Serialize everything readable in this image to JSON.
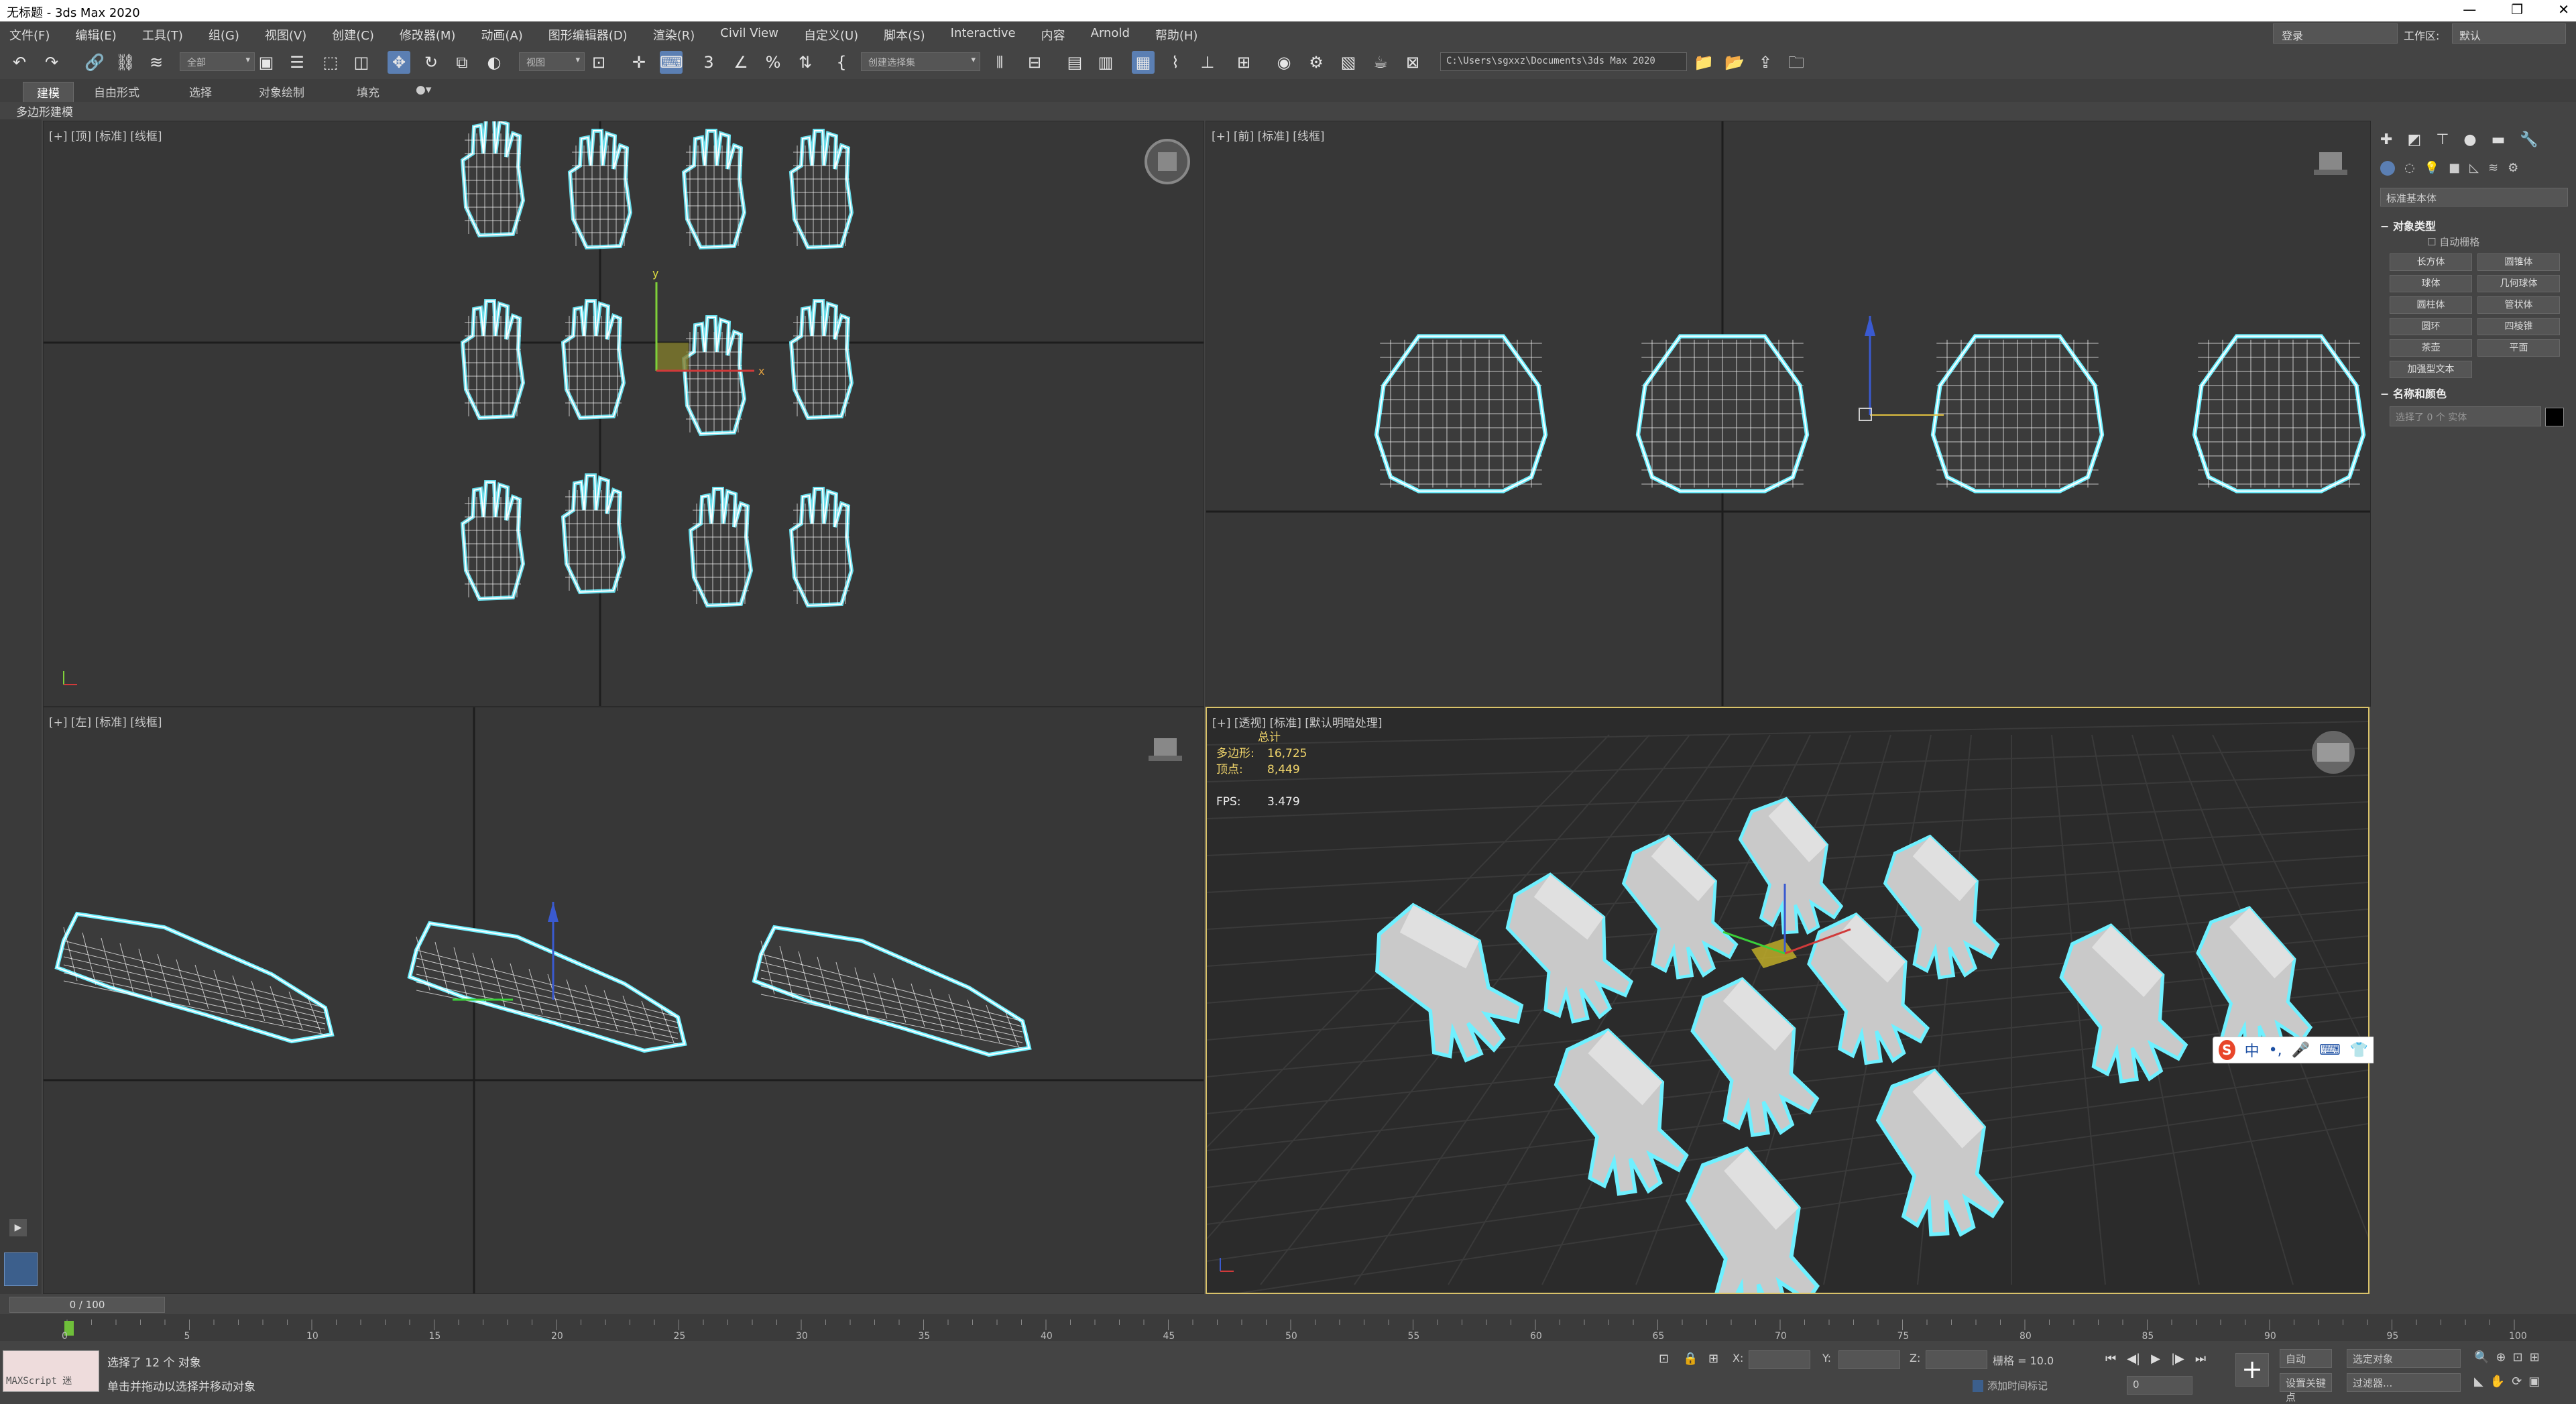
{
  "window": {
    "title": "无标题 - 3ds Max 2020",
    "controls": [
      "—",
      "❐",
      "✕"
    ]
  },
  "menu": [
    "文件(F)",
    "编辑(E)",
    "工具(T)",
    "组(G)",
    "视图(V)",
    "创建(C)",
    "修改器(M)",
    "动画(A)",
    "图形编辑器(D)",
    "渲染(R)",
    "Civil View",
    "自定义(U)",
    "脚本(S)",
    "Interactive",
    "内容",
    "Arnold",
    "帮助(H)"
  ],
  "account": {
    "login": "登录",
    "workspace_label": "工作区:",
    "workspace_value": "默认"
  },
  "toolbar": {
    "selection_filter": "全部",
    "ref_coord": "视图",
    "named_selection": "创建选择集",
    "project_path": "C:\\Users\\sgxxz\\Documents\\3ds Max 2020"
  },
  "ribbon": {
    "tabs": [
      "建模",
      "自由形式",
      "选择",
      "对象绘制",
      "填充"
    ],
    "active": "建模",
    "sub": "多边形建模"
  },
  "viewports": {
    "top": "[+] [顶] [标准] [线框]",
    "front": "[+] [前] [标准] [线框]",
    "left": "[+] [左] [标准] [线框]",
    "perspective": "[+] [透视] [标准] [默认明暗处理]"
  },
  "stats": {
    "title": "总计",
    "poly_label": "多边形:",
    "poly_value": "16,725",
    "vert_label": "顶点:",
    "vert_value": "8,449",
    "fps_label": "FPS:",
    "fps_value": "3.479"
  },
  "command_panel": {
    "category": "标准基本体",
    "rollout_object_type": "对象类型",
    "auto_grid": "自动栅格",
    "buttons": [
      "长方体",
      "圆锥体",
      "球体",
      "几何球体",
      "圆柱体",
      "管状体",
      "圆环",
      "四棱锥",
      "茶壶",
      "平面",
      "加强型文本"
    ],
    "rollout_name_color": "名称和颜色",
    "name_placeholder": "选择了 0 个 实体",
    "color": "#000000"
  },
  "timeline": {
    "frame_display": "0 / 100",
    "ticks": [
      "0",
      "5",
      "10",
      "15",
      "20",
      "25",
      "30",
      "35",
      "40",
      "45",
      "50",
      "55",
      "60",
      "65",
      "70",
      "75",
      "80",
      "85",
      "90",
      "95",
      "100"
    ]
  },
  "status": {
    "maxscript": "MAXScript 迷",
    "line1": "选择了 12 个 对象",
    "line2": "单击并拖动以选择并移动对象",
    "x_label": "X:",
    "y_label": "Y:",
    "z_label": "Z:",
    "grid": "栅格 = 10.0",
    "add_time_tag": "添加时间标记",
    "auto_key": "自动",
    "set_key": "设置关键点",
    "key_filter_dd": "选定对象",
    "key_filters": "过滤器...",
    "frame": "0"
  },
  "ime": {
    "logo": "S",
    "lang": "中",
    "items": [
      "•,",
      "🎤",
      "⌨",
      "👕",
      "▦"
    ]
  }
}
